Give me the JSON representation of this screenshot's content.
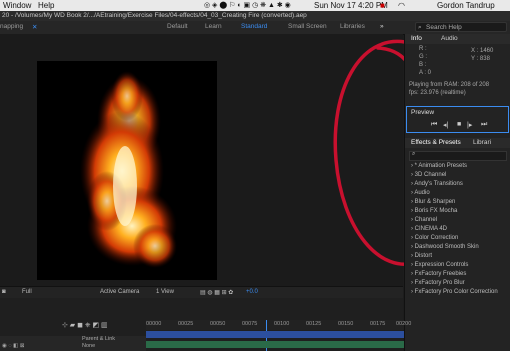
{
  "menubar": {
    "items": [
      "Window",
      "Help"
    ],
    "status_time": "Sun Nov 17  4:20 PM",
    "user": "Gordon Tandrup"
  },
  "titlebar": {
    "path": "20 - /Volumes/My WD Book 2/.../AEtraining/Exercise Files/04-effects/04_03_Creating Fire (converted).aep"
  },
  "toolbar": {
    "snapping": "napping",
    "workspaces": [
      "Default",
      "Learn",
      "Standard",
      "Small Screen",
      "Libraries"
    ],
    "active_workspace": "Standard",
    "search_placeholder": "Search Help"
  },
  "info_panel": {
    "tabs": [
      "Info",
      "Audio"
    ],
    "r": "R :",
    "g": "G :",
    "b": "B :",
    "a": "A : 0",
    "x": "X : 1460",
    "y": "Y : 838",
    "playing": "Playing from RAM: 208 of 208",
    "fps": "fps: 23.976 (realtime)"
  },
  "preview_panel": {
    "title": "Preview",
    "controls": [
      "first-frame-icon",
      "prev-frame-icon",
      "stop-icon",
      "next-frame-icon",
      "last-frame-icon"
    ]
  },
  "effects_panel": {
    "tabs": [
      "Effects & Presets",
      "Librari"
    ],
    "search_placeholder": "",
    "items": [
      "* Animation Presets",
      "3D Channel",
      "Andy's Transitions",
      "Audio",
      "Blur & Sharpen",
      "Boris FX Mocha",
      "Channel",
      "CINEMA 4D",
      "Color Correction",
      "Dashwood Smooth Skin",
      "Distort",
      "Expression Controls",
      "FxFactory Freebies",
      "FxFactory Pro Blur",
      "FxFactory Pro Color Correction"
    ]
  },
  "viewer_bar": {
    "zoom": "Full",
    "camera": "Active Camera",
    "views": "1 View",
    "exposure": "+0.0"
  },
  "timeline": {
    "ruler": [
      "00000",
      "00025",
      "00050",
      "00075",
      "00100",
      "00125",
      "00150",
      "00175",
      "00200"
    ],
    "parent_label": "Parent & Link",
    "parent_value": "None"
  },
  "colors": {
    "accent_blue": "#3b8cf0",
    "annotation_red": "#c8102e"
  }
}
